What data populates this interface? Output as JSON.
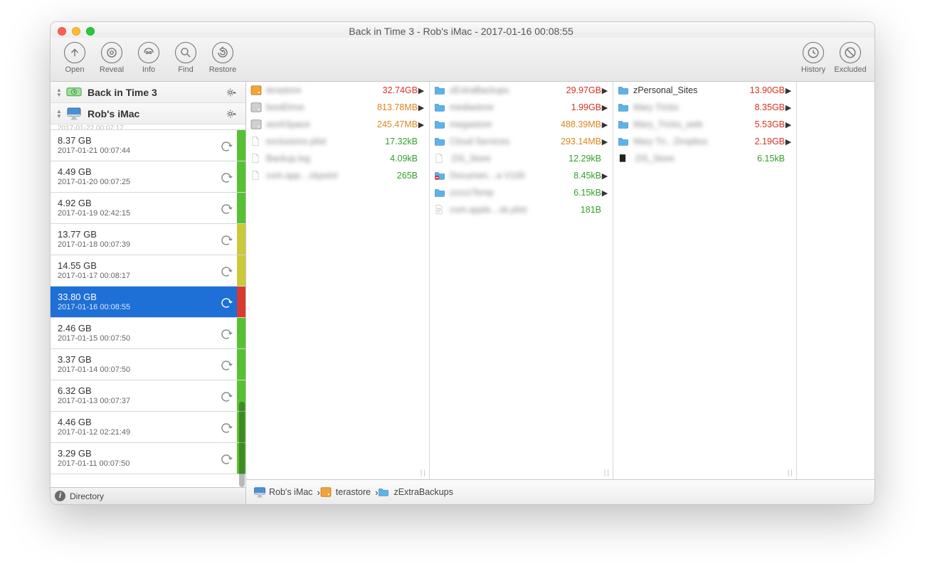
{
  "window_title": "Back in Time 3 - Rob's iMac - 2017-01-16 00:08:55",
  "toolbar": {
    "open": "Open",
    "reveal": "Reveal",
    "info": "Info",
    "find": "Find",
    "restore": "Restore",
    "history": "History",
    "excluded": "Excluded"
  },
  "sources": {
    "product": "Back in Time 3",
    "machine": "Rob's iMac"
  },
  "snapshots": [
    {
      "size": "8.37 GB",
      "date": "2017-01-21 00:07:44",
      "bar": "#56c132",
      "sel": false
    },
    {
      "size": "4.49 GB",
      "date": "2017-01-20 00:07:25",
      "bar": "#56c132",
      "sel": false
    },
    {
      "size": "4.92 GB",
      "date": "2017-01-19 02:42:15",
      "bar": "#56c132",
      "sel": false
    },
    {
      "size": "13.77 GB",
      "date": "2017-01-18 00:07:39",
      "bar": "#c9c93a",
      "sel": false
    },
    {
      "size": "14.55 GB",
      "date": "2017-01-17 00:08:17",
      "bar": "#c9c93a",
      "sel": false
    },
    {
      "size": "33.80 GB",
      "date": "2017-01-16 00:08:55",
      "bar": "#d93a2f",
      "sel": true
    },
    {
      "size": "2.46 GB",
      "date": "2017-01-15 00:07:50",
      "bar": "#56c132",
      "sel": false
    },
    {
      "size": "3.37 GB",
      "date": "2017-01-14 00:07:50",
      "bar": "#56c132",
      "sel": false
    },
    {
      "size": "6.32 GB",
      "date": "2017-01-13 00:07:37",
      "bar": "#56c132",
      "sel": false
    },
    {
      "size": "4.46 GB",
      "date": "2017-01-12 02:21:49",
      "bar": "#56c132",
      "sel": false
    },
    {
      "size": "3.29 GB",
      "date": "2017-01-11 00:07:50",
      "bar": "#56c132",
      "sel": false
    }
  ],
  "columns": [
    [
      {
        "icon": "hdd-orange",
        "name": "terastore",
        "size": "32.74GB",
        "sc": "sz-red",
        "arr": true,
        "blur": true
      },
      {
        "icon": "hdd-gray",
        "name": "bootDrive",
        "size": "813.78MB",
        "sc": "sz-orange",
        "arr": true,
        "blur": true
      },
      {
        "icon": "hdd-gray",
        "name": "workSpace",
        "size": "245.47MB",
        "sc": "sz-orange",
        "arr": true,
        "blur": true
      },
      {
        "icon": "file",
        "name": "exclusions.plist",
        "size": "17.32kB",
        "sc": "sz-green",
        "arr": false,
        "blur": true
      },
      {
        "icon": "file",
        "name": "Backup.log",
        "size": "4.09kB",
        "sc": "sz-green",
        "arr": false,
        "blur": true
      },
      {
        "icon": "file",
        "name": "com.app…ckpoint",
        "size": "265B",
        "sc": "sz-green",
        "arr": false,
        "blur": true
      }
    ],
    [
      {
        "icon": "folder",
        "name": "zExtraBackups",
        "size": "29.97GB",
        "sc": "sz-red",
        "arr": true,
        "blur": true
      },
      {
        "icon": "folder",
        "name": "mediastore",
        "size": "1.99GB",
        "sc": "sz-red",
        "arr": true,
        "blur": true
      },
      {
        "icon": "folder",
        "name": "megastore",
        "size": "488.39MB",
        "sc": "sz-orange",
        "arr": true,
        "blur": true
      },
      {
        "icon": "folder",
        "name": "Cloud Services",
        "size": "293.14MB",
        "sc": "sz-orange",
        "arr": true,
        "blur": true
      },
      {
        "icon": "file",
        "name": ".DS_Store",
        "size": "12.29kB",
        "sc": "sz-green",
        "arr": false,
        "blur": true
      },
      {
        "icon": "folder-deny",
        "name": "Documen…a V100",
        "size": "8.45kB",
        "sc": "sz-green",
        "arr": true,
        "blur": true
      },
      {
        "icon": "folder",
        "name": "zzzzzTemp",
        "size": "6.15kB",
        "sc": "sz-green",
        "arr": true,
        "blur": true
      },
      {
        "icon": "plist",
        "name": "com.apple…sk.plist",
        "size": "181B",
        "sc": "sz-green",
        "arr": false,
        "blur": true
      }
    ],
    [
      {
        "icon": "folder",
        "name": "zPersonal_Sites",
        "size": "13.90GB",
        "sc": "sz-red",
        "arr": true,
        "blur": false
      },
      {
        "icon": "folder",
        "name": "Mary Tricks",
        "size": "8.35GB",
        "sc": "sz-red",
        "arr": true,
        "blur": true
      },
      {
        "icon": "folder",
        "name": "Mary_Tricks_web",
        "size": "5.53GB",
        "sc": "sz-red",
        "arr": true,
        "blur": true
      },
      {
        "icon": "folder",
        "name": "Mary Tri…Dropbox",
        "size": "2.19GB",
        "sc": "sz-red",
        "arr": true,
        "blur": true
      },
      {
        "icon": "file-dark",
        "name": ".DS_Store",
        "size": "6.15kB",
        "sc": "sz-green",
        "arr": false,
        "blur": true
      }
    ]
  ],
  "breadcrumbs": [
    {
      "icon": "imac",
      "label": "Rob's iMac"
    },
    {
      "icon": "hdd-orange",
      "label": "terastore"
    },
    {
      "icon": "folder",
      "label": "zExtraBackups"
    }
  ],
  "status": "Directory"
}
